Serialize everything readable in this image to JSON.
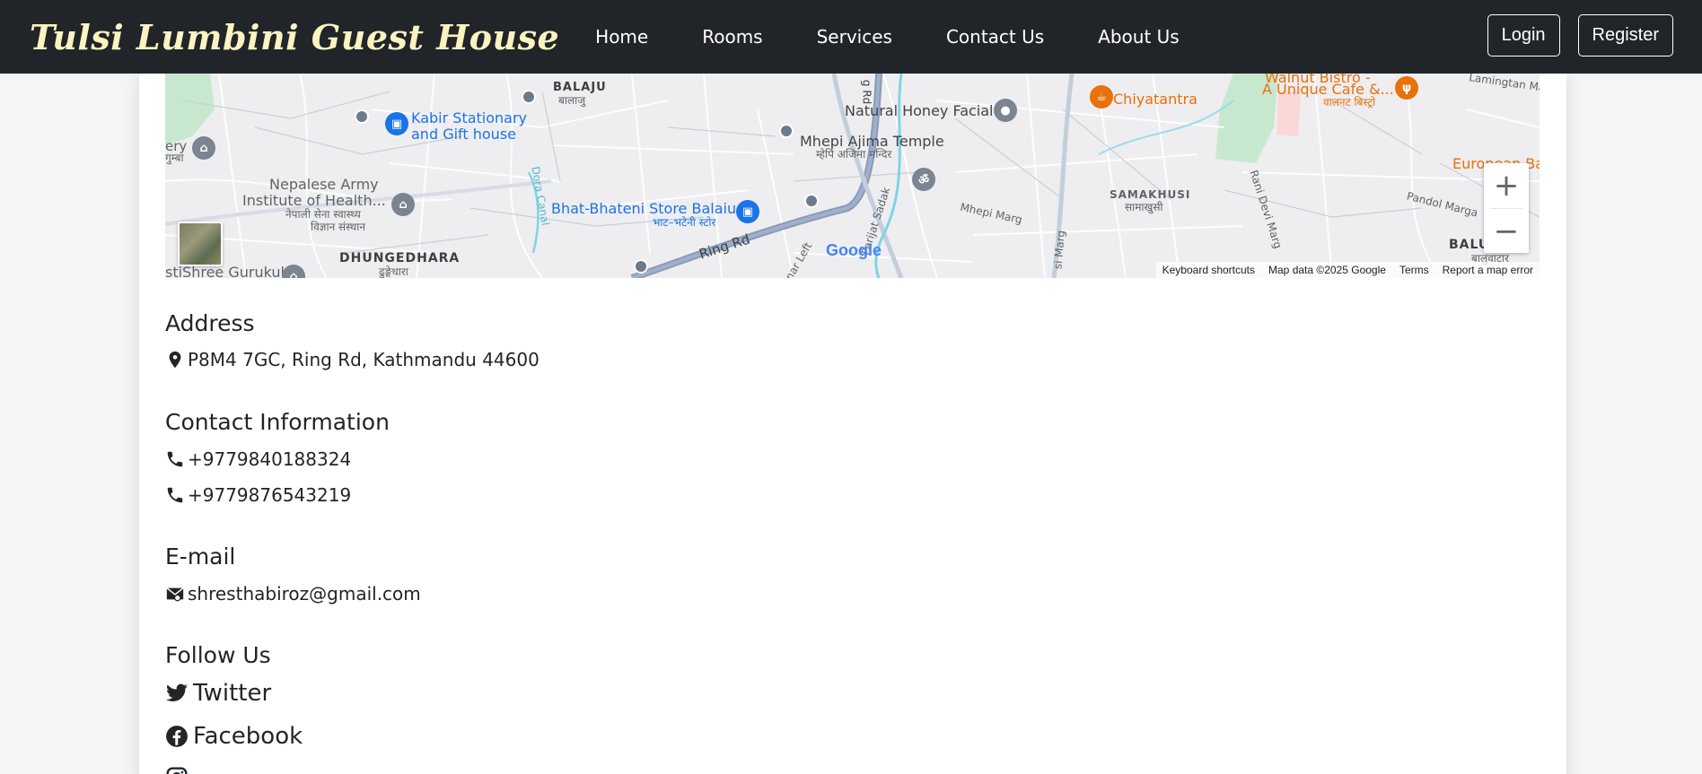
{
  "navbar": {
    "brand": "Tulsi Lumbini Guest House",
    "links": [
      "Home",
      "Rooms",
      "Services",
      "Contact Us",
      "About Us"
    ],
    "login_label": "Login",
    "register_label": "Register"
  },
  "map": {
    "labels": {
      "balaju": "BALAJU",
      "balaju_np": "बालाजु",
      "kabir1": "Kabir Stationary",
      "kabir2": "and Gift house",
      "natural_honey": "Natural Honey Facial",
      "chiyatantra": "Chiyatantra",
      "walnut1": "Walnut Bistro -",
      "walnut2": "A Unique Cafe &...",
      "walnut_np": "वालनट बिस्ट्रो",
      "lamingtan": "Lamingtan Ma",
      "mhepi": "Mhepi Ajima Temple",
      "mhepi_np": "म्हेपि अजिमा मन्दिर",
      "nepalese1": "Nepalese Army",
      "nepalese2": "Institute of Health...",
      "nepalese_np1": "नेपाली सेना स्वास्थ्य",
      "nepalese_np2": "विज्ञान संस्थान",
      "bhat": "Bhat-Bhateni Store Balaiu",
      "bhat_np": "भाट–भटेनी स्टोर",
      "samakhusi": "SAMAKHUSI",
      "samakhusi_np": "सामाखुसी",
      "dhungedhara": "DHUNGEDHARA",
      "dhungedhara_np": "ढुङ्गेधारा",
      "gurukul": "stiShree Gurukul",
      "ring_rd": "Ring Rd",
      "mhepi_marg": "Mhepi Marg",
      "pandol": "Pandol Marga",
      "baluwa": "BALUWA",
      "baluwa_np": "बालुवाटार",
      "europe": "European Ba",
      "gallery": "ery",
      "gallery_np": "गुम्बा",
      "dora": "Dora Canal",
      "ranidevi": "Rani Devi Marg",
      "parijat": "Parijat Sadak",
      "ringrd_vert": "g Rd",
      "nar_left": "nar Left",
      "si_marg": "si Marg"
    },
    "google_logo": "Google",
    "zoom_in": "+",
    "zoom_out": "−",
    "footer": {
      "shortcuts": "Keyboard shortcuts",
      "map_data": "Map data ©2025 Google",
      "terms": "Terms",
      "report": "Report a map error"
    }
  },
  "address": {
    "title": "Address",
    "value": "P8M4 7GC, Ring Rd, Kathmandu 44600"
  },
  "contact": {
    "title": "Contact Information",
    "phones": [
      "+9779840188324",
      "+9779876543219"
    ]
  },
  "email": {
    "title": "E-mail",
    "value": "shresthabiroz@gmail.com"
  },
  "follow": {
    "title": "Follow Us",
    "twitter": "Twitter",
    "facebook": "Facebook"
  }
}
